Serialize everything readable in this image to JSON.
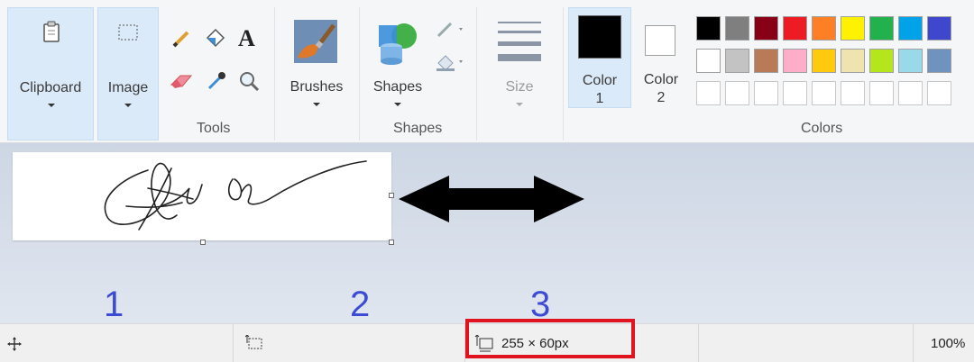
{
  "ribbon": {
    "clipboard": {
      "label": "Clipboard",
      "icon": "clipboard-icon"
    },
    "image": {
      "label": "Image",
      "icon": "select-icon"
    },
    "tools": {
      "group_label": "Tools",
      "items": [
        "pencil-icon",
        "fill-icon",
        "text-icon",
        "eraser-icon",
        "color-picker-icon",
        "magnifier-icon"
      ],
      "text_tool_glyph": "A"
    },
    "brushes": {
      "label": "Brushes",
      "icon": "brush-icon"
    },
    "shapes": {
      "label": "Shapes",
      "group_label": "Shapes",
      "icon": "shapes-icon",
      "outline_icon": "outline-icon",
      "fill_icon": "shape-fill-icon"
    },
    "size": {
      "label": "Size",
      "icon": "size-icon"
    },
    "color1": {
      "label_line1": "Color",
      "label_line2": "1",
      "value": "#000000"
    },
    "color2": {
      "label_line1": "Color",
      "label_line2": "2",
      "value": "#ffffff"
    },
    "colors": {
      "group_label": "Colors",
      "row1": [
        "#000000",
        "#7f7f7f",
        "#880015",
        "#ed1c24",
        "#ff7f27",
        "#fff200",
        "#22b14c",
        "#00a2e8",
        "#3f48cc"
      ],
      "row2": [
        "#ffffff",
        "#c3c3c3",
        "#b97a57",
        "#ffaec9",
        "#ffc90e",
        "#efe4b0",
        "#b5e61d",
        "#99d9ea",
        "#7092be"
      ],
      "row3": [
        "#ffffff",
        "#ffffff",
        "#ffffff",
        "#ffffff",
        "#ffffff",
        "#ffffff",
        "#ffffff",
        "#ffffff",
        "#ffffff"
      ]
    }
  },
  "canvas": {
    "content": "signature-image",
    "arrow": "double-arrow"
  },
  "annotations": [
    "1",
    "2",
    "3"
  ],
  "status": {
    "cursor_icon": "move-icon",
    "selection_icon": "selection-size-icon",
    "size_icon": "canvas-size-icon",
    "image_size": "255 × 60px",
    "zoom": "100%"
  },
  "highlight_color": "#e0141e"
}
